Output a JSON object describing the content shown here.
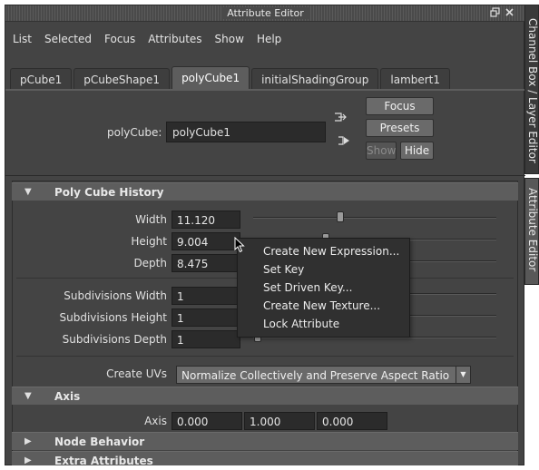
{
  "window": {
    "title": "Attribute Editor"
  },
  "menu": [
    "List",
    "Selected",
    "Focus",
    "Attributes",
    "Show",
    "Help"
  ],
  "tabs": [
    {
      "label": "pCube1",
      "active": false
    },
    {
      "label": "pCubeShape1",
      "active": false
    },
    {
      "label": "polyCube1",
      "active": true
    },
    {
      "label": "initialShadingGroup",
      "active": false
    },
    {
      "label": "lambert1",
      "active": false
    }
  ],
  "node": {
    "label": "polyCube:",
    "value": "polyCube1"
  },
  "buttons": {
    "focus": "Focus",
    "presets": "Presets",
    "show": "Show",
    "hide": "Hide"
  },
  "sections": {
    "history": "Poly Cube History",
    "axis": "Axis",
    "node_behavior": "Node Behavior",
    "extra": "Extra Attributes"
  },
  "attributes": {
    "width": {
      "label": "Width",
      "value": "11.120",
      "slider_fraction": 0.36
    },
    "height": {
      "label": "Height",
      "value": "9.004",
      "slider_fraction": 0.3
    },
    "depth": {
      "label": "Depth",
      "value": "8.475"
    },
    "subdiv_width": {
      "label": "Subdivisions Width",
      "value": "1"
    },
    "subdiv_height": {
      "label": "Subdivisions Height",
      "value": "1"
    },
    "subdiv_depth": {
      "label": "Subdivisions Depth",
      "value": "1"
    },
    "create_uvs": {
      "label": "Create UVs",
      "value": "Normalize Collectively and Preserve Aspect Ratio"
    },
    "axis": {
      "label": "Axis",
      "x": "0.000",
      "y": "1.000",
      "z": "0.000"
    }
  },
  "context_menu": [
    "Create New Expression...",
    "Set Key",
    "Set Driven Key...",
    "Create New Texture...",
    "Lock Attribute"
  ],
  "side_tabs": {
    "channel_box": "Channel Box / Layer Editor",
    "attribute_editor": "Attribute Editor"
  },
  "icons": [
    "restore-icon",
    "close-icon",
    "expand-triangle-icon",
    "collapse-triangle-icon",
    "mouse-cursor-icon",
    "input-connection-icon",
    "output-connection-icon"
  ]
}
